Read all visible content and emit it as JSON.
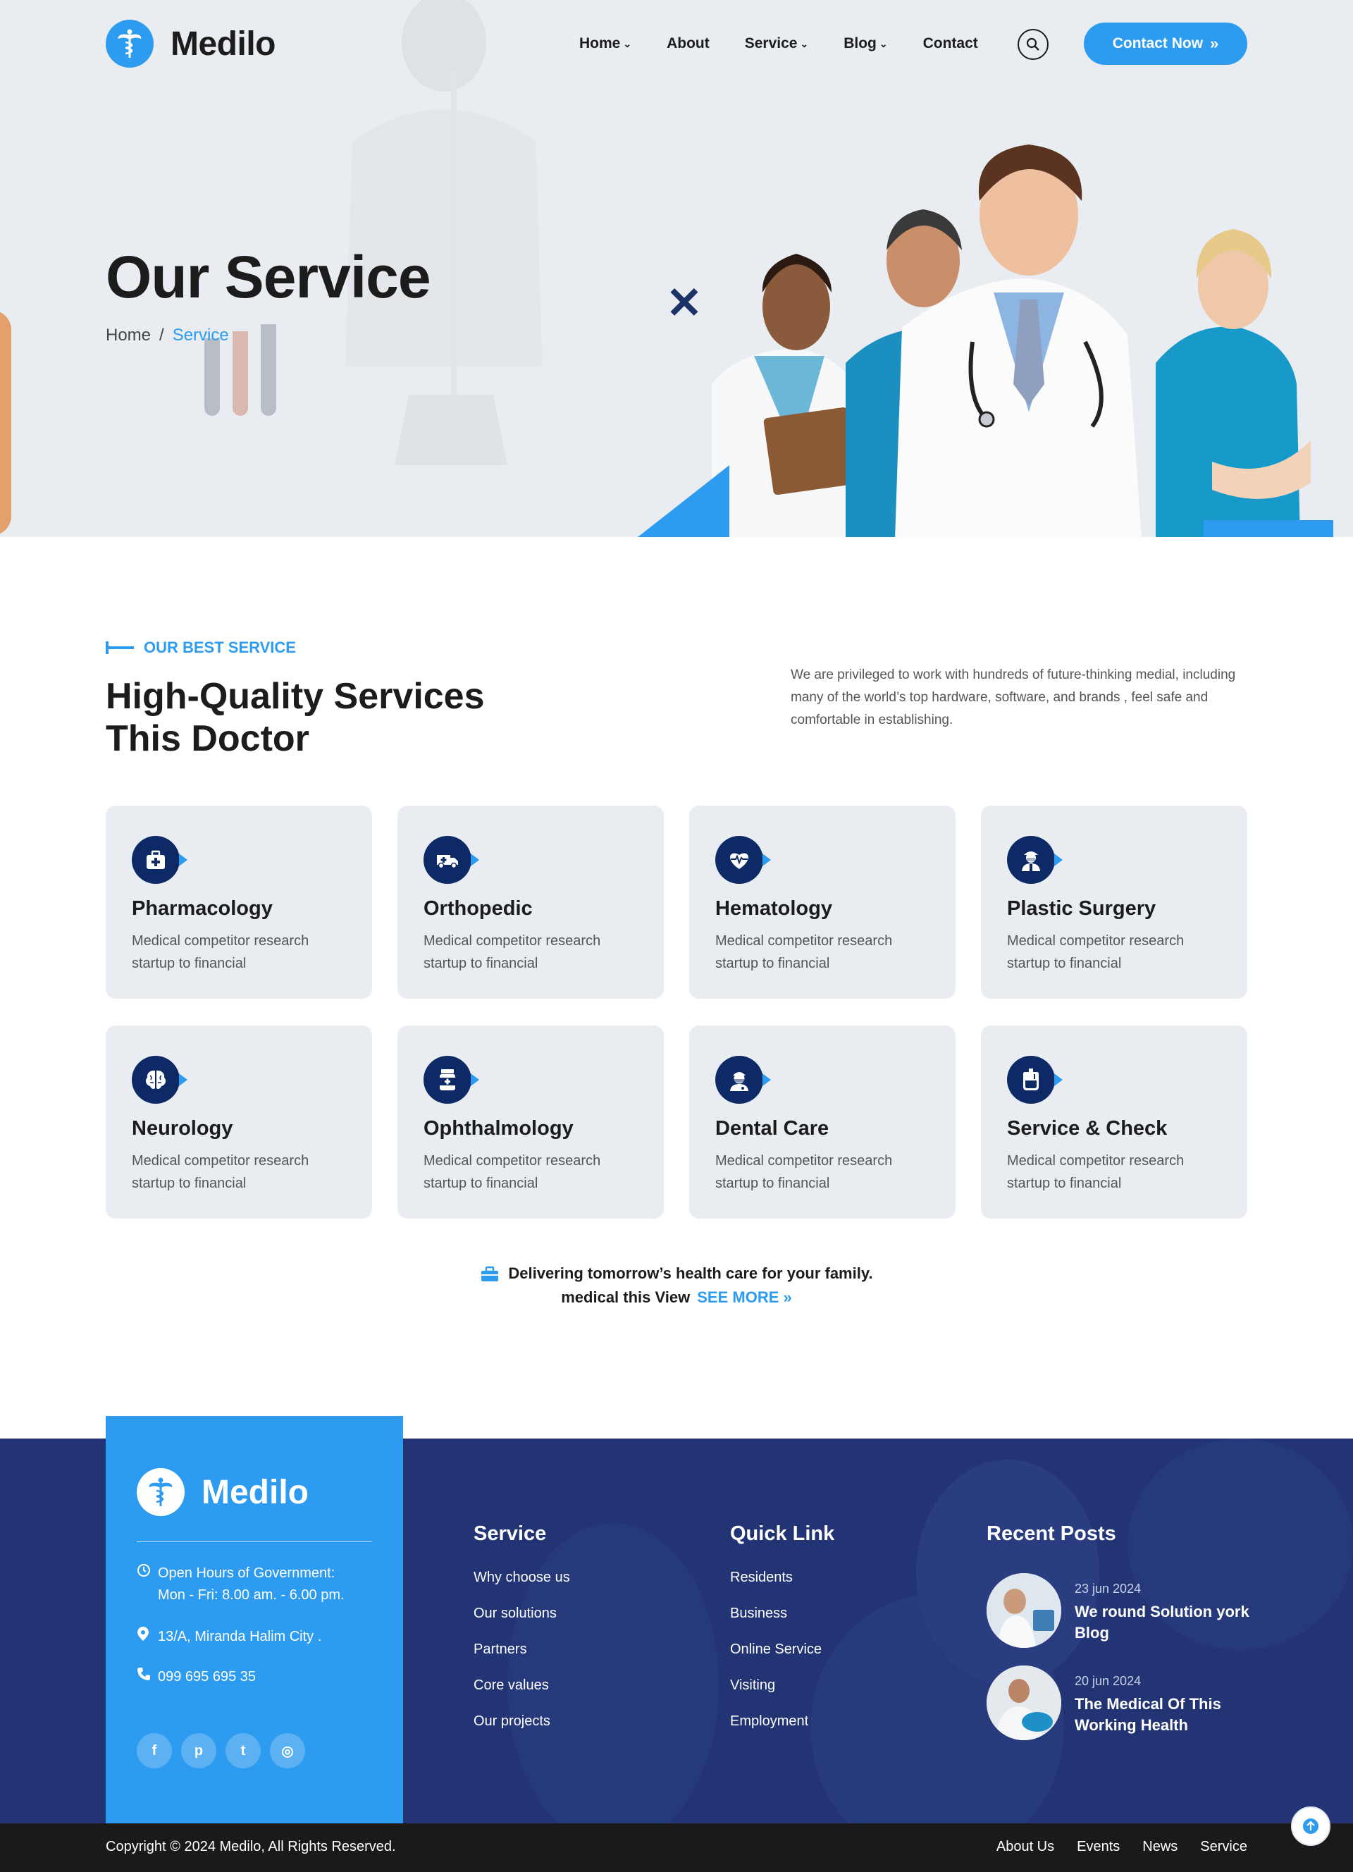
{
  "brand": {
    "name": "Medilo",
    "accent": "#2d9bef",
    "navy": "#0e2a66"
  },
  "nav": {
    "items": [
      {
        "label": "Home",
        "dropdown": true
      },
      {
        "label": "About",
        "dropdown": false
      },
      {
        "label": "Service",
        "dropdown": true
      },
      {
        "label": "Blog",
        "dropdown": true
      },
      {
        "label": "Contact",
        "dropdown": false
      }
    ],
    "search_icon": "search-icon",
    "cta_label": "Contact Now"
  },
  "hero": {
    "title": "Our Service",
    "breadcrumb": [
      "Home",
      "/",
      "Service"
    ]
  },
  "services": {
    "tag": "OUR BEST SERVICE",
    "title_line1": "High-Quality Services",
    "title_line2": "This Doctor",
    "description": "We are privileged to work with hundreds of future-thinking medial, including many of the world’s top hardware, software, and brands , feel safe and comfortable in establishing.",
    "cards": [
      {
        "title": "Pharmacology",
        "desc": "Medical competitor research startup to financial",
        "icon": "first-aid-kit-icon"
      },
      {
        "title": "Orthopedic",
        "desc": "Medical competitor research startup to financial",
        "icon": "ambulance-icon"
      },
      {
        "title": "Hematology",
        "desc": "Medical competitor research startup to financial",
        "icon": "heartbeat-icon"
      },
      {
        "title": "Plastic Surgery",
        "desc": "Medical competitor research startup to financial",
        "icon": "surgeon-icon"
      },
      {
        "title": "Neurology",
        "desc": "Medical competitor research startup to financial",
        "icon": "brain-icon"
      },
      {
        "title": "Ophthalmology",
        "desc": "Medical competitor research startup to financial",
        "icon": "medicine-bottle-icon"
      },
      {
        "title": "Dental Care",
        "desc": "Medical competitor research startup to financial",
        "icon": "doctor-mask-icon"
      },
      {
        "title": "Service & Check",
        "desc": "Medical competitor research startup to financial",
        "icon": "blood-bag-icon"
      }
    ],
    "cta_line1": "Delivering tomorrow’s health care for your family.",
    "cta_line2": "medical this View",
    "cta_link": "SEE MORE"
  },
  "footer": {
    "brand": "Medilo",
    "hours_label": "Open Hours of Government:",
    "hours_value": "Mon - Fri: 8.00 am. - 6.00 pm.",
    "address": "13/A, Miranda Halim City .",
    "phone": "099 695 695 35",
    "social": [
      {
        "icon": "facebook-icon",
        "glyph": "f"
      },
      {
        "icon": "pinterest-icon",
        "glyph": "p"
      },
      {
        "icon": "twitter-icon",
        "glyph": "t"
      },
      {
        "icon": "instagram-icon",
        "glyph": "◎"
      }
    ],
    "col_service": {
      "title": "Service",
      "links": [
        "Why choose us",
        "Our solutions",
        "Partners",
        "Core values",
        "Our projects"
      ]
    },
    "col_quick": {
      "title": "Quick Link",
      "links": [
        "Residents",
        "Business",
        "Online Service",
        "Visiting",
        "Employment"
      ]
    },
    "recent": {
      "title": "Recent Posts",
      "posts": [
        {
          "date": "23 jun 2024",
          "title": "We round Solution york Blog"
        },
        {
          "date": "20 jun 2024",
          "title": "The Medical Of This Working Health"
        }
      ]
    }
  },
  "bottom": {
    "copyright": "Copyright © 2024 Medilo, All Rights Reserved.",
    "links": [
      "About Us",
      "Events",
      "News",
      "Service"
    ]
  }
}
